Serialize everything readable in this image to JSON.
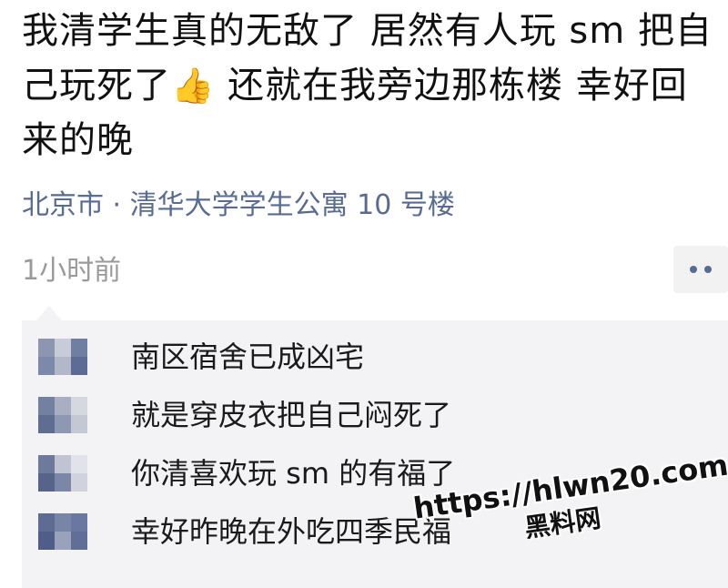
{
  "post": {
    "text_part1": "我清学生真的无敌了 居然有人玩 sm 把自己玩死了",
    "thumb_icon": "thumbs-up-icon",
    "thumb_glyph": "👍",
    "text_part2": " 还就在我旁边那栋楼 幸好回来的晚",
    "location": "北京市 · 清华大学学生公寓 10 号楼",
    "time": "1小时前"
  },
  "comments": [
    {
      "text": "南区宿舍已成凶宅"
    },
    {
      "text": "就是穿皮衣把自己闷死了"
    },
    {
      "text": "你清喜欢玩 sm 的有福了"
    },
    {
      "text": "幸好昨晚在外吃四季民福"
    }
  ],
  "watermark": {
    "url": "https://hlwn20.com",
    "name": "黑料网"
  },
  "colors": {
    "link_blue": "#576b95",
    "time_gray": "#9a9a9a",
    "comment_bg": "#f3f3f5",
    "thumb_yellow": "#f5b400",
    "thumb_green": "#2fa84f"
  }
}
